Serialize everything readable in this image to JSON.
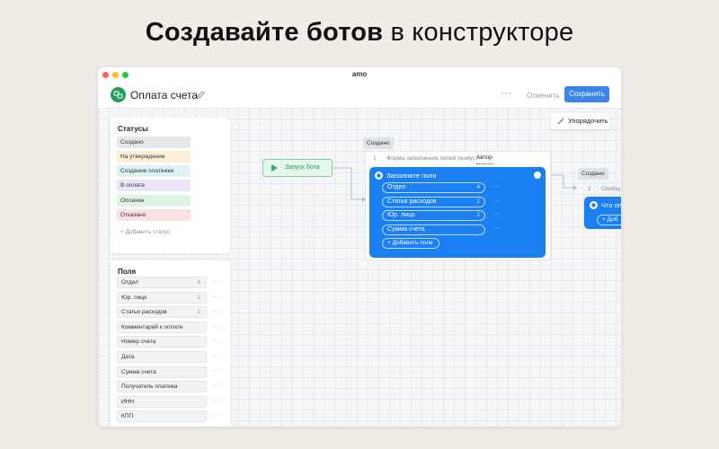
{
  "headline": {
    "bold": "Создавайте ботов",
    "rest": "в конструкторе"
  },
  "window": {
    "title": "amo"
  },
  "appbar": {
    "page_title": "Оплата счета",
    "more": "···",
    "cancel_label": "Отменить",
    "save_label": "Сохранить"
  },
  "colors": {
    "accent": "#1a7ff0",
    "save": "#3a86e8",
    "start_green": "#27b264",
    "logo": "#1f9e5a"
  },
  "statuses": {
    "title": "Статусы",
    "items": [
      {
        "label": "Создано",
        "bg": "#e6e8eb"
      },
      {
        "label": "На утверждении",
        "bg": "#fbf0d6"
      },
      {
        "label": "Создание платежки",
        "bg": "#dff3f5"
      },
      {
        "label": "В оплате",
        "bg": "#e8e6f8"
      },
      {
        "label": "Оплачен",
        "bg": "#def4e3"
      },
      {
        "label": "Отказано",
        "bg": "#fbe1e4"
      }
    ],
    "add_label": "+ Добавить статус"
  },
  "fields": {
    "title": "Поля",
    "items": [
      {
        "label": "Отдел",
        "count": "4"
      },
      {
        "label": "Юр. лицо",
        "count": "2"
      },
      {
        "label": "Статья расходов",
        "count": "2"
      },
      {
        "label": "Комментарий к оплате",
        "count": ""
      },
      {
        "label": "Номер счета",
        "count": ""
      },
      {
        "label": "Дата",
        "count": ""
      },
      {
        "label": "Сумма счета",
        "count": ""
      },
      {
        "label": "Получатель платежа",
        "count": ""
      },
      {
        "label": "ИНН",
        "count": ""
      },
      {
        "label": "КПП",
        "count": ""
      }
    ],
    "dots": "···"
  },
  "canvas": {
    "tidy_label": "Упорядочить",
    "start_label": "Запуск бота",
    "created_tag": "Создано",
    "form": {
      "num": "1",
      "label": "Форма заполнения полей (кому):",
      "author": "Автор"
    },
    "fill_card": {
      "title": "Заполните поля",
      "items": [
        {
          "label": "Отдел",
          "count": "4"
        },
        {
          "label": "Статья расходов",
          "count": "2"
        },
        {
          "label": "Юр. лицо",
          "count": "2"
        },
        {
          "label": "Сумма счета",
          "count": ""
        }
      ],
      "add_label": "+ Добавить поле",
      "dots": "···"
    },
    "second": {
      "created_tag": "Создано",
      "num": "2",
      "label": "Сообщ",
      "card_title": "Что оп",
      "add_label": "+ Доб"
    }
  }
}
